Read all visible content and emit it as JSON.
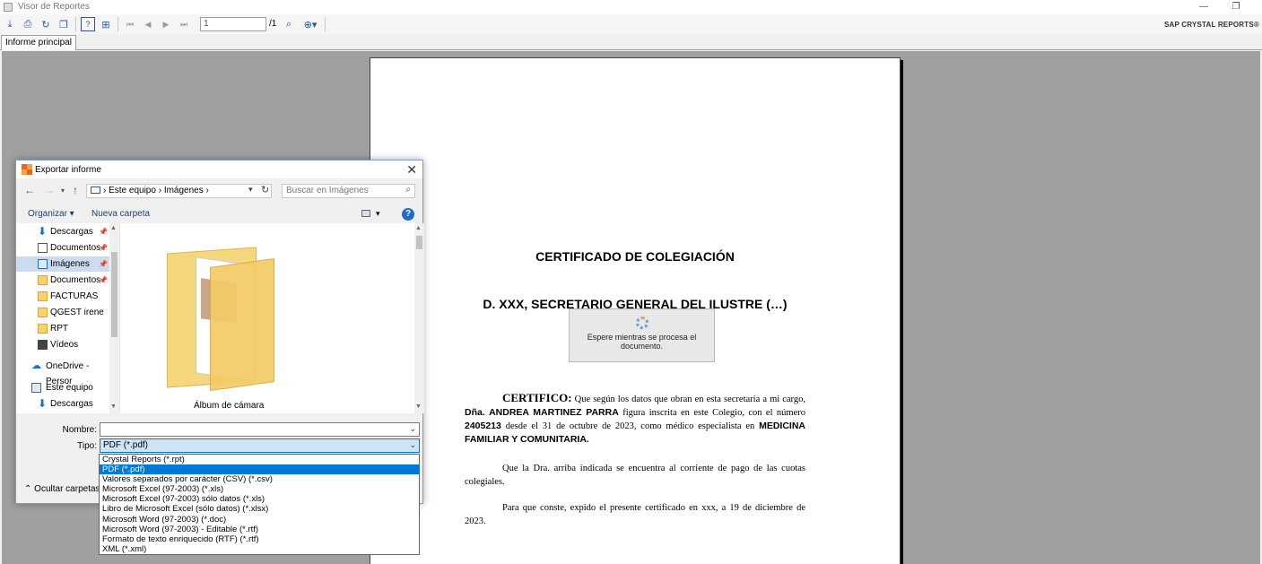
{
  "window": {
    "title": "Visor de Reportes",
    "minimize": "—",
    "restore": "❐"
  },
  "toolbar": {
    "page_value": "1",
    "page_total": "/1",
    "brand": "SAP CRYSTAL REPORTS®"
  },
  "tabs": [
    {
      "label": "Informe principal"
    }
  ],
  "report": {
    "title": "CERTIFICADO DE COLEGIACIÓN",
    "subtitle": "D. XXX, SECRETARIO GENERAL DEL ILUSTRE (…)",
    "p1_head": "CERTIFICO:",
    "p1_a": " Que según los datos que obran en esta secretaría a mi cargo, ",
    "p1_name": "Dña. ANDREA MARTINEZ PARRA",
    "p1_b": "  figura inscrita  en este Colegio, con el número ",
    "p1_number": "2405213",
    "p1_c": " desde el 31 de octubre de 2023, como médico especialista en ",
    "p1_specialty": "MEDICINA FAMILIAR Y COMUNITARIA.",
    "p2": "Que la Dra. arriba indicada se encuentra al corriente de pago  de las cuotas colegiales.",
    "p3": "Para que conste, expido el presente certificado en  xxx, a   19 de diciembre de 2023.",
    "wait_text": "Espere mientras se procesa el documento."
  },
  "dialog": {
    "title": "Exportar informe",
    "close": "✕",
    "breadcrumb": [
      "Este equipo",
      "Imágenes"
    ],
    "search_placeholder": "Buscar en Imágenes",
    "organize": "Organizar ▾",
    "new_folder": "Nueva carpeta",
    "help": "?",
    "nav_items": [
      {
        "label": "Descargas",
        "icon": "download-icon"
      },
      {
        "label": "Documentos",
        "icon": "document-icon"
      },
      {
        "label": "Imágenes",
        "icon": "pictures-icon",
        "selected": true
      },
      {
        "label": "Documentos",
        "icon": "folder-icon"
      },
      {
        "label": "FACTURAS",
        "icon": "folder-icon"
      },
      {
        "label": "QGEST irene",
        "icon": "folder-icon"
      },
      {
        "label": "RPT",
        "icon": "folder-icon"
      },
      {
        "label": "Vídeos",
        "icon": "video-icon"
      },
      {
        "label": "OneDrive - Persor",
        "icon": "cloud-icon"
      },
      {
        "label": "Este equipo",
        "icon": "computer-icon"
      },
      {
        "label": "Descargas",
        "icon": "download-icon"
      }
    ],
    "folder_label": "Álbum de cámara",
    "name_label": "Nombre:",
    "name_value": "",
    "type_label": "Tipo:",
    "type_value": "PDF (*.pdf)",
    "hide_folders": "Ocultar carpetas",
    "type_options": [
      "Crystal Reports (*.rpt)",
      "PDF (*.pdf)",
      "Valores separados por carácter (CSV) (*.csv)",
      "Microsoft Excel (97-2003) (*.xls)",
      "Microsoft Excel (97-2003) sólo datos (*.xls)",
      "Libro de Microsoft Excel (sólo datos) (*.xlsx)",
      "Microsoft Word (97-2003) (*.doc)",
      "Microsoft Word (97-2003) - Editable (*.rtf)",
      "Formato de texto enriquecido (RTF) (*.rtf)",
      "XML (*.xml)"
    ],
    "selected_option": 1
  }
}
